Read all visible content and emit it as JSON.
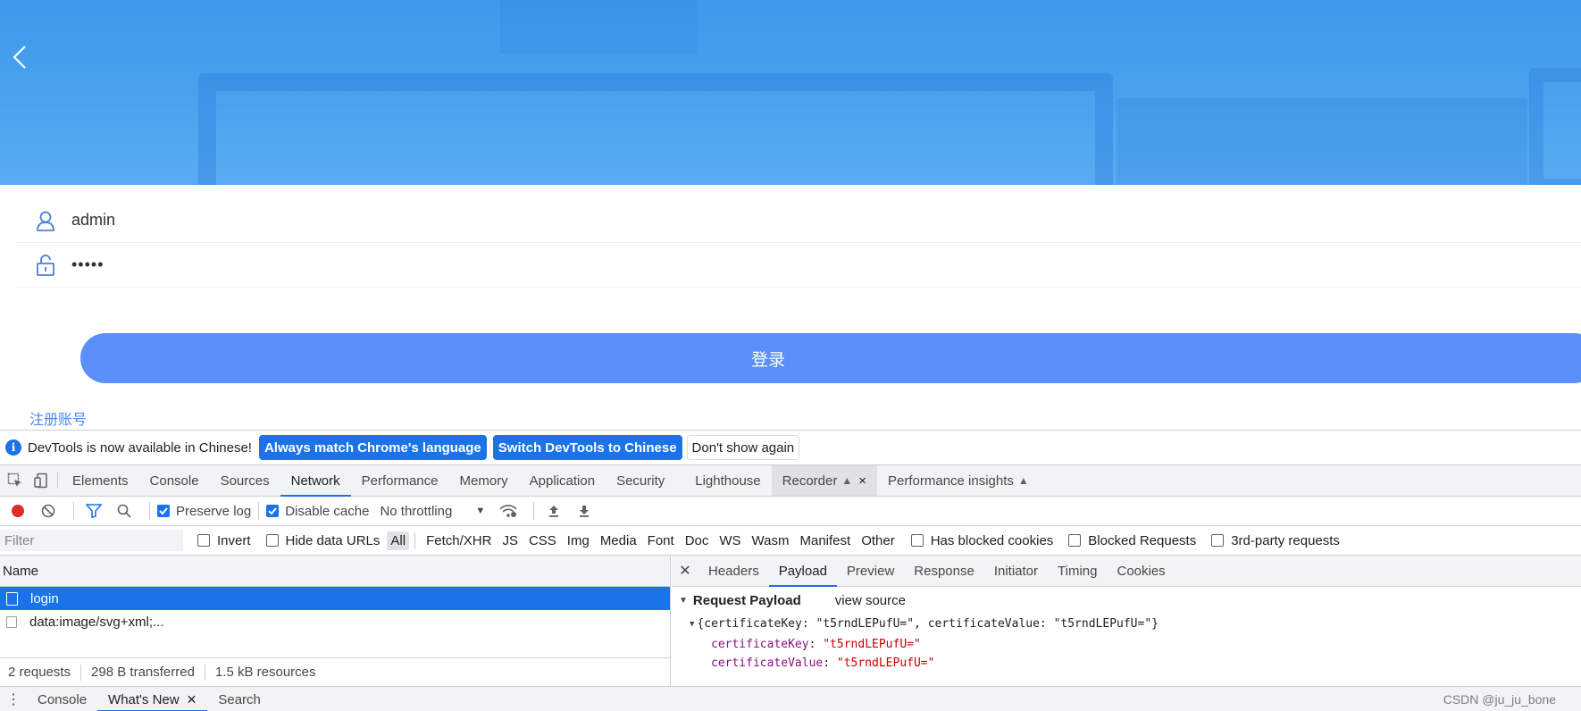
{
  "app": {
    "username_value": "admin",
    "password_mask": "•••••",
    "login_label": "登录",
    "register_label": "注册账号",
    "accent_color": "#5b8ff9"
  },
  "devtools": {
    "infobar": {
      "message": "DevTools is now available in Chinese!",
      "btn_match": "Always match Chrome's language",
      "btn_switch": "Switch DevTools to Chinese",
      "btn_dismiss": "Don't show again"
    },
    "tabs": [
      "Elements",
      "Console",
      "Sources",
      "Network",
      "Performance",
      "Memory",
      "Application",
      "Security",
      "Lighthouse",
      "Recorder",
      "Performance insights"
    ],
    "active_tab": "Network",
    "toolbar": {
      "preserve_log": "Preserve log",
      "disable_cache": "Disable cache",
      "throttling": "No throttling"
    },
    "filterbar": {
      "placeholder": "Filter",
      "invert": "Invert",
      "hide_data_urls": "Hide data URLs",
      "types": [
        "All",
        "Fetch/XHR",
        "JS",
        "CSS",
        "Img",
        "Media",
        "Font",
        "Doc",
        "WS",
        "Wasm",
        "Manifest",
        "Other"
      ],
      "has_blocked_cookies": "Has blocked cookies",
      "blocked_requests": "Blocked Requests",
      "third_party": "3rd-party requests"
    },
    "requests": {
      "header": "Name",
      "rows": [
        "login",
        "data:image/svg+xml;..."
      ],
      "summary_count": "2 requests",
      "summary_transferred": "298 B transferred",
      "summary_resources": "1.5 kB resources"
    },
    "detail": {
      "tabs": [
        "Headers",
        "Payload",
        "Preview",
        "Response",
        "Initiator",
        "Timing",
        "Cookies"
      ],
      "active": "Payload",
      "section_title": "Request Payload",
      "view_source": "view source",
      "object_summary": "{certificateKey: \"t5rndLEPufU=\", certificateValue: \"t5rndLEPufU=\"}",
      "key1": "certificateKey",
      "val1": "\"t5rndLEPufU=\"",
      "key2": "certificateValue",
      "val2": "\"t5rndLEPufU=\""
    },
    "drawer": {
      "tabs": [
        "Console",
        "What's New",
        "Search"
      ],
      "active": "What's New"
    }
  },
  "watermark": "CSDN @ju_ju_bone"
}
